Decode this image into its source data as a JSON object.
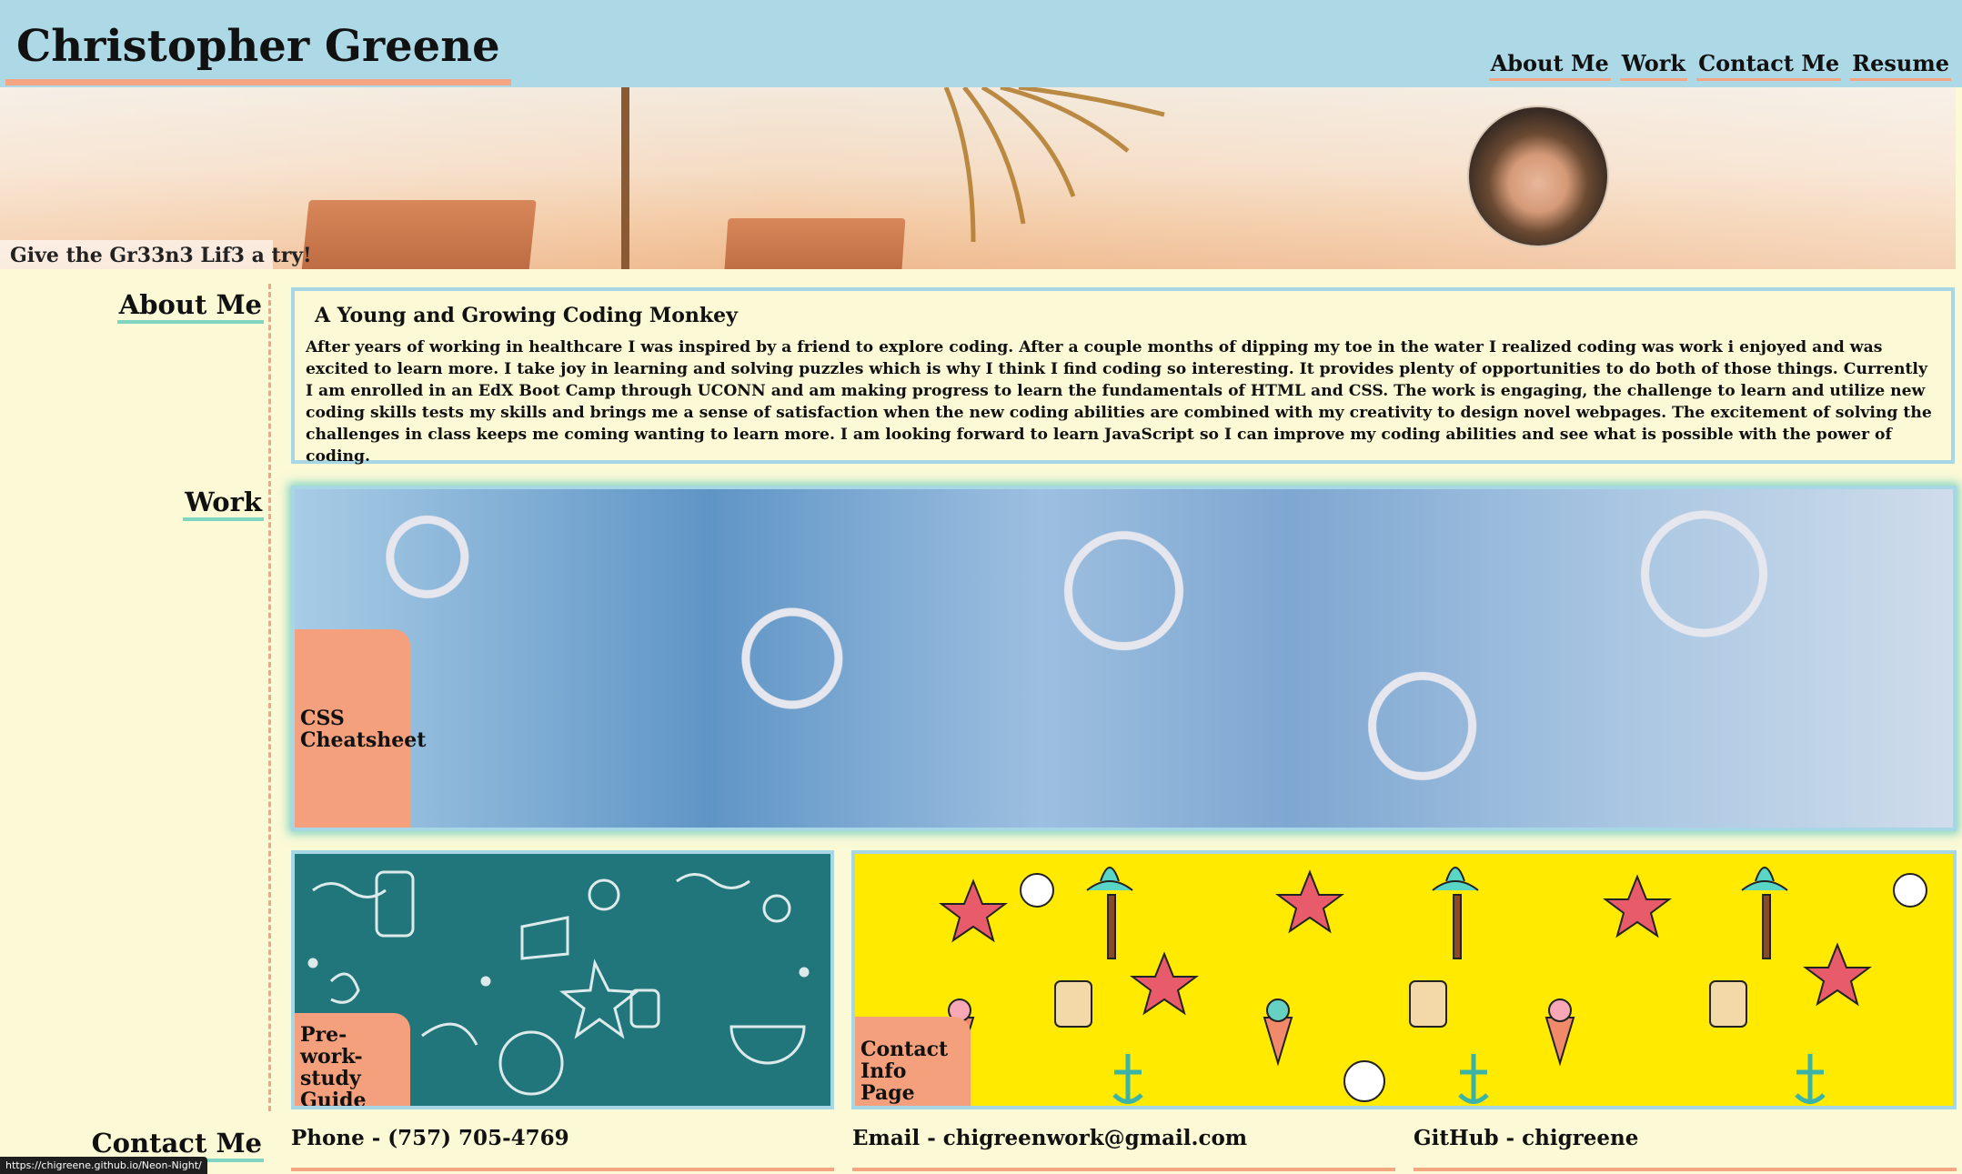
{
  "header": {
    "title": "Christopher Greene",
    "nav": [
      "About Me",
      "Work",
      "Contact Me",
      "Resume"
    ]
  },
  "hero": {
    "tagline": "Give the Gr33n3 Lif3 a try!"
  },
  "about": {
    "label": "About Me",
    "heading": "A Young and Growing Coding Monkey",
    "text": "After years of working in healthcare I was inspired by a friend to explore coding. After a couple months of dipping my toe in the water I realized coding was work i enjoyed and was excited to learn more. I take joy in learning and solving puzzles which is why I think I find coding so interesting. It provides plenty of opportunities to do both of those things. Currently I am enrolled in an EdX Boot Camp through UCONN and am making progress to learn the fundamentals of HTML and CSS. The work is engaging, the challenge to learn and utilize new coding skills tests my skills and brings me a sense of satisfaction when the new coding abilities are combined with my creativity to design novel webpages. The excitement of solving the challenges in class keeps me coming wanting to learn more. I am looking forward to learn JavaScript so I can improve my coding abilities and see what is possible with the power of coding."
  },
  "work": {
    "label": "Work",
    "tiles": [
      {
        "label": "CSS Cheatsheet"
      },
      {
        "label": "Pre-work-study Guide"
      },
      {
        "label": "Contact Info Page"
      }
    ]
  },
  "contact": {
    "label": "Contact Me",
    "phone": "Phone - (757) 705-4769",
    "email": "Email - chigreenwork@gmail.com",
    "github": "GitHub - chigreene"
  },
  "status_bar": {
    "url": "https://chigreene.github.io/Neon-Night/"
  },
  "colors": {
    "header_bg": "#add8e6",
    "page_bg": "#fbf9d6",
    "accent_salmon": "#f4a581",
    "accent_teal": "#7fd4c2",
    "tile_border": "#a7d6e4"
  }
}
